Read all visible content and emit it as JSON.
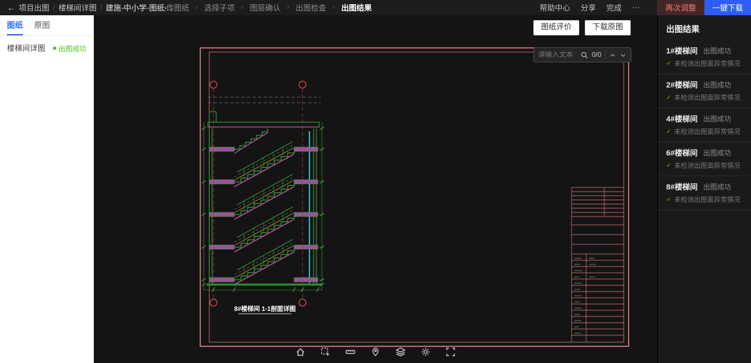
{
  "topbar": {
    "back": "←",
    "project_breadcrumb": {
      "separator": "/",
      "items": [
        "项目出图",
        "楼梯间详图",
        "建施-中小学-图纸-..."
      ]
    },
    "steps": {
      "separator": "›",
      "items": [
        {
          "label": "上传图纸",
          "active": false
        },
        {
          "label": "选择子项",
          "active": false
        },
        {
          "label": "图层确认",
          "active": false
        },
        {
          "label": "出图检查",
          "active": false
        },
        {
          "label": "出图结果",
          "active": true
        }
      ]
    },
    "help_center": "帮助中心",
    "share": "分享",
    "finish": "完成",
    "more": "···",
    "readjust_button": "再次调整",
    "download_all_button": "一键下载"
  },
  "sidebar": {
    "tabs": [
      {
        "label": "图纸",
        "active": true
      },
      {
        "label": "原图",
        "active": false
      }
    ],
    "items": [
      {
        "label": "楼梯间详图",
        "status": "出图成功"
      }
    ]
  },
  "canvas": {
    "evaluate_button": "图纸评价",
    "download_original_button": "下载原图",
    "search": {
      "placeholder": "请输入文本",
      "count": "0/0"
    },
    "drawing": {
      "title": "8#楼梯间 1-1剖面详图"
    },
    "toolbar_icons": [
      "home",
      "box-select",
      "measure",
      "marker",
      "layers",
      "settings",
      "fullscreen"
    ]
  },
  "results": {
    "title": "出图结果",
    "check_mark": "✓",
    "items": [
      {
        "name": "1#楼梯间",
        "status": "出图成功",
        "detail": "未检测出图面异常情况"
      },
      {
        "name": "2#楼梯间",
        "status": "出图成功",
        "detail": "未检测出图面异常情况"
      },
      {
        "name": "4#楼梯间",
        "status": "出图成功",
        "detail": "未检测出图面异常情况"
      },
      {
        "name": "6#楼梯间",
        "status": "出图成功",
        "detail": "未检测出图面异常情况"
      },
      {
        "name": "8#楼梯间",
        "status": "出图成功",
        "detail": "未检测出图面异常情况"
      }
    ]
  },
  "colors": {
    "accent_blue": "#2e5cf6",
    "success_green": "#52c41a",
    "danger_red": "#ef7b7b",
    "frame_pink": "#d87878",
    "cad_green": "#3fae3f",
    "cad_magenta": "#b4519e",
    "cad_cyan": "#3ecbdc"
  }
}
